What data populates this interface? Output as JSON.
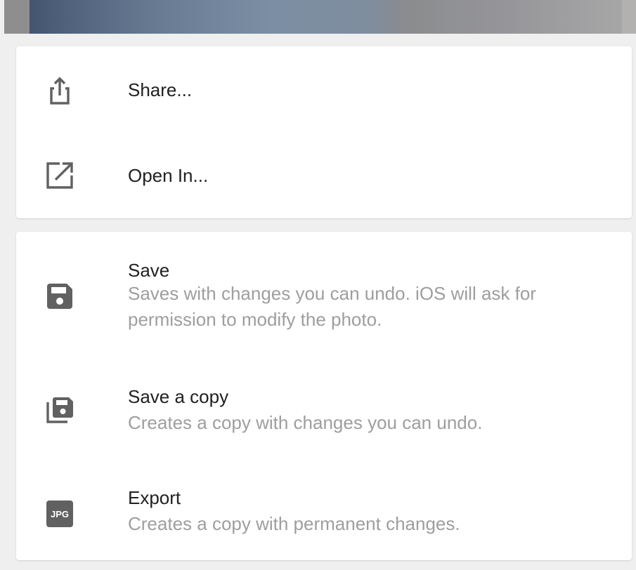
{
  "menu": {
    "share": {
      "label": "Share...",
      "icon": "share-icon"
    },
    "open_in": {
      "label": "Open In...",
      "icon": "open-in-icon"
    },
    "save": {
      "label": "Save",
      "description": "Saves with changes you can undo. iOS will ask for permission to modify the photo.",
      "icon": "save-icon"
    },
    "save_copy": {
      "label": "Save a copy",
      "description": "Creates a copy with changes you can undo.",
      "icon": "save-copy-icon"
    },
    "export": {
      "label": "Export",
      "description": "Creates a copy with permanent changes.",
      "icon": "jpg-icon",
      "icon_text": "JPG"
    }
  },
  "colors": {
    "label": "#212121",
    "description": "#9e9e9e",
    "icon": "#616161",
    "card": "#ffffff",
    "background": "#efefef"
  }
}
